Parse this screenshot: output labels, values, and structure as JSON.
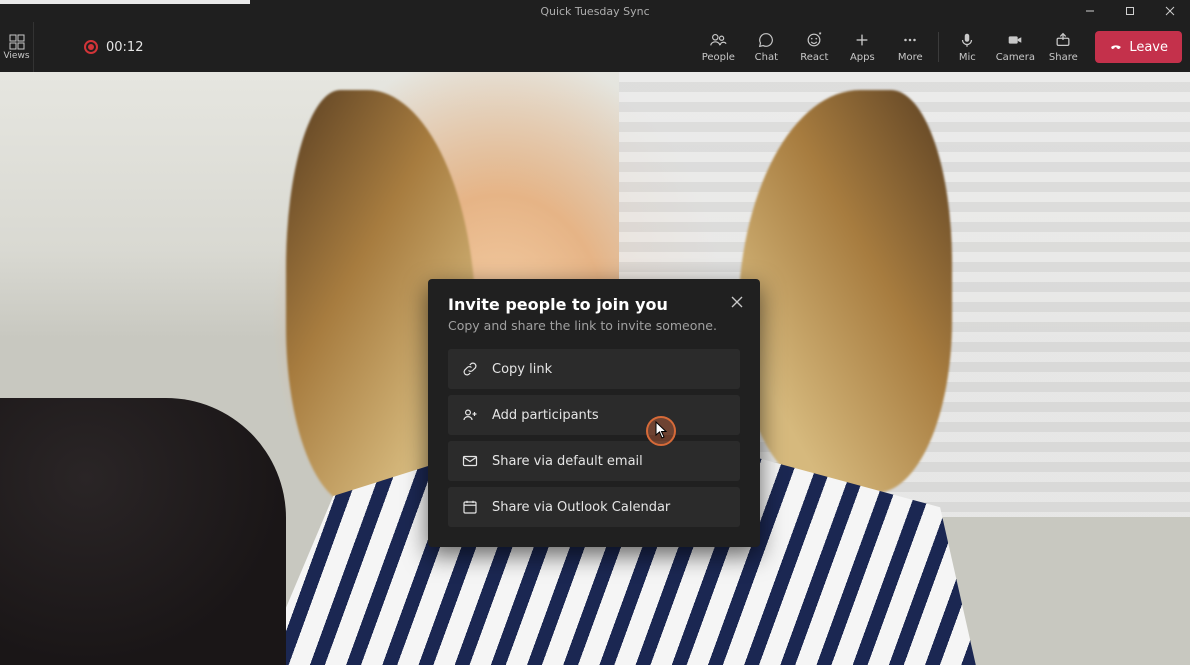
{
  "window": {
    "title": "Quick Tuesday Sync"
  },
  "toolbar": {
    "views_label": "Views",
    "timer": "00:12",
    "items": [
      {
        "label": "People",
        "icon": "people-icon"
      },
      {
        "label": "Chat",
        "icon": "chat-icon"
      },
      {
        "label": "React",
        "icon": "react-icon"
      },
      {
        "label": "Apps",
        "icon": "apps-icon"
      },
      {
        "label": "More",
        "icon": "more-icon"
      }
    ],
    "device_items": [
      {
        "label": "Mic",
        "icon": "mic-icon"
      },
      {
        "label": "Camera",
        "icon": "camera-icon"
      },
      {
        "label": "Share",
        "icon": "share-icon"
      }
    ],
    "leave_label": "Leave"
  },
  "modal": {
    "title": "Invite people to join you",
    "subtitle": "Copy and share the link to invite someone.",
    "options": [
      {
        "label": "Copy link",
        "icon": "link-icon"
      },
      {
        "label": "Add participants",
        "icon": "add-people-icon"
      },
      {
        "label": "Share via default email",
        "icon": "mail-icon"
      },
      {
        "label": "Share via Outlook Calendar",
        "icon": "calendar-icon"
      }
    ]
  }
}
